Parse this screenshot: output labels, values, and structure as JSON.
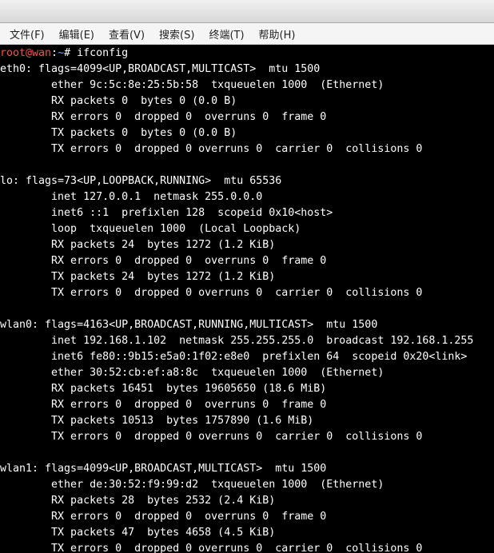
{
  "menubar": {
    "file": "文件(F)",
    "edit": "编辑(E)",
    "view": "查看(V)",
    "search": "搜索(S)",
    "terminal": "终端(T)",
    "help": "帮助(H)"
  },
  "prompt": {
    "user_host": "root@wan",
    "separator": ":",
    "path": "~",
    "hash": "# ",
    "command": "ifconfig"
  },
  "output_lines": [
    "eth0: flags=4099<UP,BROADCAST,MULTICAST>  mtu 1500",
    "        ether 9c:5c:8e:25:5b:58  txqueuelen 1000  (Ethernet)",
    "        RX packets 0  bytes 0 (0.0 B)",
    "        RX errors 0  dropped 0  overruns 0  frame 0",
    "        TX packets 0  bytes 0 (0.0 B)",
    "        TX errors 0  dropped 0 overruns 0  carrier 0  collisions 0",
    "",
    "lo: flags=73<UP,LOOPBACK,RUNNING>  mtu 65536",
    "        inet 127.0.0.1  netmask 255.0.0.0",
    "        inet6 ::1  prefixlen 128  scopeid 0x10<host>",
    "        loop  txqueuelen 1000  (Local Loopback)",
    "        RX packets 24  bytes 1272 (1.2 KiB)",
    "        RX errors 0  dropped 0  overruns 0  frame 0",
    "        TX packets 24  bytes 1272 (1.2 KiB)",
    "        TX errors 0  dropped 0 overruns 0  carrier 0  collisions 0",
    "",
    "wlan0: flags=4163<UP,BROADCAST,RUNNING,MULTICAST>  mtu 1500",
    "        inet 192.168.1.102  netmask 255.255.255.0  broadcast 192.168.1.255",
    "        inet6 fe80::9b15:e5a0:1f02:e8e0  prefixlen 64  scopeid 0x20<link>",
    "        ether 30:52:cb:ef:a8:8c  txqueuelen 1000  (Ethernet)",
    "        RX packets 16451  bytes 19605650 (18.6 MiB)",
    "        RX errors 0  dropped 0  overruns 0  frame 0",
    "        TX packets 10513  bytes 1757890 (1.6 MiB)",
    "        TX errors 0  dropped 0 overruns 0  carrier 0  collisions 0",
    "",
    "wlan1: flags=4099<UP,BROADCAST,MULTICAST>  mtu 1500",
    "        ether de:30:52:f9:99:d2  txqueuelen 1000  (Ethernet)",
    "        RX packets 28  bytes 2532 (2.4 KiB)",
    "        RX errors 0  dropped 0  overruns 0  frame 0",
    "        TX packets 47  bytes 4658 (4.5 KiB)",
    "        TX errors 0  dropped 0 overruns 0  carrier 0  collisions 0"
  ]
}
